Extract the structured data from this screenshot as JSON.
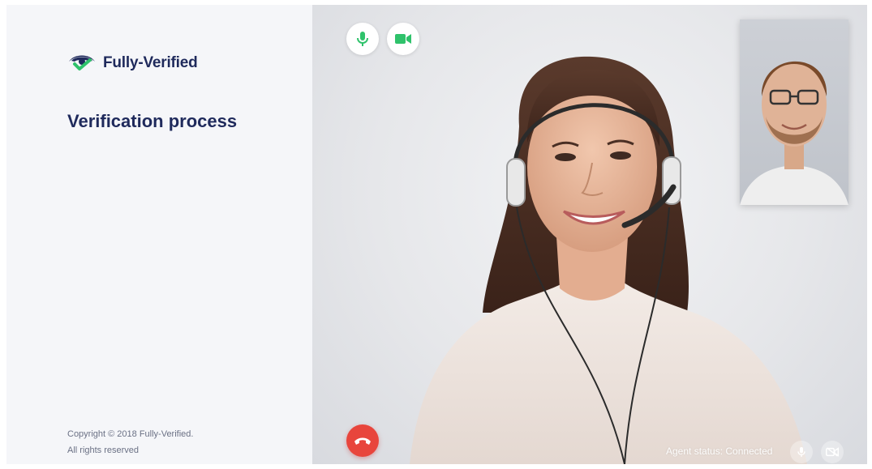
{
  "brand": {
    "name": "Fully-Verified",
    "colors": {
      "navy": "#1f2a5c",
      "green": "#2fc26b",
      "hangup_red": "#e8453c"
    }
  },
  "page": {
    "title": "Verification process"
  },
  "footer": {
    "copyright_line1": "Copyright © 2018 Fully-Verified.",
    "copyright_line2": "All rights reserved"
  },
  "call": {
    "controls": {
      "mic_icon": "microphone-icon",
      "camera_icon": "video-camera-icon",
      "hangup_icon": "phone-hangup-icon"
    },
    "agent": {
      "status_text": "Agent status: Connected",
      "mic_icon": "microphone-icon",
      "camera_icon": "video-camera-off-icon"
    }
  }
}
